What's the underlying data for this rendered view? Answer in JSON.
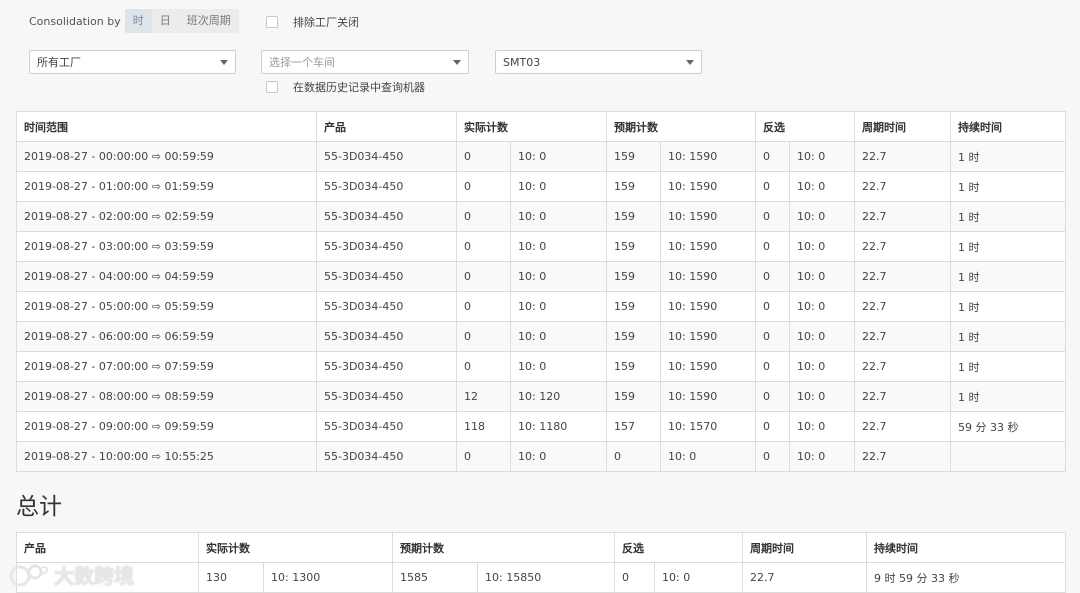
{
  "consolidation": {
    "label": "Consolidation by",
    "options": [
      "时",
      "日",
      "班次周期"
    ],
    "active_index": 0
  },
  "exclude_factory_closed": {
    "label": "排除工厂关闭",
    "checked": false
  },
  "filters": {
    "factory": {
      "value": "所有工厂"
    },
    "workshop": {
      "placeholder": "选择一个车间"
    },
    "machine": {
      "value": "SMT03"
    }
  },
  "history_query": {
    "label": "在数据历史记录中查询机器",
    "checked": false
  },
  "main_table": {
    "headers": {
      "time_range": "时间范围",
      "product": "产品",
      "actual": "实际计数",
      "expected": "预期计数",
      "reject": "反选",
      "cycle": "周期时间",
      "duration": "持续时间"
    },
    "rows": [
      {
        "time": "2019-08-27 - 00:00:00 ⇨ 00:59:59",
        "product": "55-3D034-450",
        "actual": "0",
        "actual_rate": "10: 0",
        "expected": "159",
        "expected_rate": "10: 1590",
        "reject": "0",
        "reject_rate": "10: 0",
        "cycle": "22.7",
        "duration": "1 时"
      },
      {
        "time": "2019-08-27 - 01:00:00 ⇨ 01:59:59",
        "product": "55-3D034-450",
        "actual": "0",
        "actual_rate": "10: 0",
        "expected": "159",
        "expected_rate": "10: 1590",
        "reject": "0",
        "reject_rate": "10: 0",
        "cycle": "22.7",
        "duration": "1 时"
      },
      {
        "time": "2019-08-27 - 02:00:00 ⇨ 02:59:59",
        "product": "55-3D034-450",
        "actual": "0",
        "actual_rate": "10: 0",
        "expected": "159",
        "expected_rate": "10: 1590",
        "reject": "0",
        "reject_rate": "10: 0",
        "cycle": "22.7",
        "duration": "1 时"
      },
      {
        "time": "2019-08-27 - 03:00:00 ⇨ 03:59:59",
        "product": "55-3D034-450",
        "actual": "0",
        "actual_rate": "10: 0",
        "expected": "159",
        "expected_rate": "10: 1590",
        "reject": "0",
        "reject_rate": "10: 0",
        "cycle": "22.7",
        "duration": "1 时"
      },
      {
        "time": "2019-08-27 - 04:00:00 ⇨ 04:59:59",
        "product": "55-3D034-450",
        "actual": "0",
        "actual_rate": "10: 0",
        "expected": "159",
        "expected_rate": "10: 1590",
        "reject": "0",
        "reject_rate": "10: 0",
        "cycle": "22.7",
        "duration": "1 时"
      },
      {
        "time": "2019-08-27 - 05:00:00 ⇨ 05:59:59",
        "product": "55-3D034-450",
        "actual": "0",
        "actual_rate": "10: 0",
        "expected": "159",
        "expected_rate": "10: 1590",
        "reject": "0",
        "reject_rate": "10: 0",
        "cycle": "22.7",
        "duration": "1 时"
      },
      {
        "time": "2019-08-27 - 06:00:00 ⇨ 06:59:59",
        "product": "55-3D034-450",
        "actual": "0",
        "actual_rate": "10: 0",
        "expected": "159",
        "expected_rate": "10: 1590",
        "reject": "0",
        "reject_rate": "10: 0",
        "cycle": "22.7",
        "duration": "1 时"
      },
      {
        "time": "2019-08-27 - 07:00:00 ⇨ 07:59:59",
        "product": "55-3D034-450",
        "actual": "0",
        "actual_rate": "10: 0",
        "expected": "159",
        "expected_rate": "10: 1590",
        "reject": "0",
        "reject_rate": "10: 0",
        "cycle": "22.7",
        "duration": "1 时"
      },
      {
        "time": "2019-08-27 - 08:00:00 ⇨ 08:59:59",
        "product": "55-3D034-450",
        "actual": "12",
        "actual_rate": "10: 120",
        "expected": "159",
        "expected_rate": "10: 1590",
        "reject": "0",
        "reject_rate": "10: 0",
        "cycle": "22.7",
        "duration": "1 时"
      },
      {
        "time": "2019-08-27 - 09:00:00 ⇨ 09:59:59",
        "product": "55-3D034-450",
        "actual": "118",
        "actual_rate": "10: 1180",
        "expected": "157",
        "expected_rate": "10: 1570",
        "reject": "0",
        "reject_rate": "10: 0",
        "cycle": "22.7",
        "duration": "59 分 33 秒"
      },
      {
        "time": "2019-08-27 - 10:00:00 ⇨ 10:55:25",
        "product": "55-3D034-450",
        "actual": "0",
        "actual_rate": "10: 0",
        "expected": "0",
        "expected_rate": "10: 0",
        "reject": "0",
        "reject_rate": "10: 0",
        "cycle": "22.7",
        "duration": ""
      }
    ]
  },
  "totals": {
    "title": "总计",
    "headers": {
      "product": "产品",
      "actual": "实际计数",
      "expected": "预期计数",
      "reject": "反选",
      "cycle": "周期时间",
      "duration": "持续时间"
    },
    "row": {
      "product": "",
      "actual": "130",
      "actual_rate": "10: 1300",
      "expected": "1585",
      "expected_rate": "10: 15850",
      "reject": "0",
      "reject_rate": "10: 0",
      "cycle": "22.7",
      "duration": "9 时 59 分 33 秒"
    }
  },
  "watermark": {
    "text": "大数跨境"
  }
}
